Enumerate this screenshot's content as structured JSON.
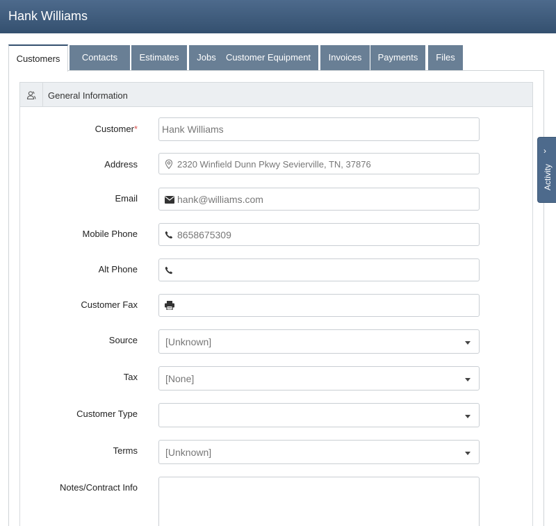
{
  "window": {
    "title": "Hank Williams"
  },
  "tabs": [
    {
      "label": "Customers",
      "active": true
    },
    {
      "label": "Contacts"
    },
    {
      "label": "Estimates"
    },
    {
      "label": "Jobs"
    },
    {
      "label": "Customer Equipment"
    },
    {
      "label": "Invoices"
    },
    {
      "label": "Payments"
    },
    {
      "label": "Files"
    }
  ],
  "section": {
    "title": "General Information",
    "icon": "users-icon"
  },
  "form": {
    "customer": {
      "label": "Customer",
      "required_mark": "*",
      "value": "Hank Williams"
    },
    "address": {
      "label": "Address",
      "value": "2320 Winfield Dunn Pkwy Sevierville, TN, 37876",
      "icon": "map-marker-icon"
    },
    "email": {
      "label": "Email",
      "value": "hank@williams.com",
      "icon": "envelope-icon"
    },
    "mobile_phone": {
      "label": "Mobile Phone",
      "value": "8658675309",
      "icon": "phone-icon"
    },
    "alt_phone": {
      "label": "Alt Phone",
      "value": "",
      "icon": "phone-icon"
    },
    "customer_fax": {
      "label": "Customer Fax",
      "value": "",
      "icon": "printer-icon"
    },
    "source": {
      "label": "Source",
      "value": "[Unknown]"
    },
    "tax": {
      "label": "Tax",
      "value": "[None]"
    },
    "customer_type": {
      "label": "Customer Type",
      "value": ""
    },
    "terms": {
      "label": "Terms",
      "value": "[Unknown]"
    },
    "notes": {
      "label": "Notes/Contract Info",
      "value": ""
    }
  },
  "activity": {
    "label": "Activity"
  },
  "colors": {
    "header": "#3f5b7c",
    "tab_inactive": "#697f95",
    "required": "#d9534f"
  }
}
